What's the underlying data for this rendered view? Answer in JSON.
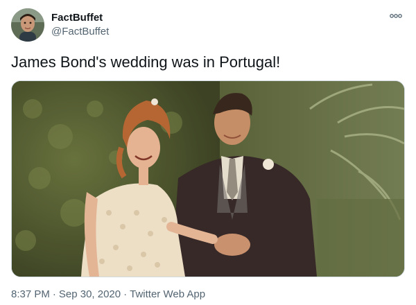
{
  "author": {
    "display_name": "FactBuffet",
    "handle": "@FactBuffet",
    "avatar_icon": "user-avatar-photo"
  },
  "menu": {
    "icon": "more-options-icon"
  },
  "tweet": {
    "text": "James Bond's wedding was in Portugal!",
    "media_icon": "wedding-photo"
  },
  "meta": {
    "time": "8:37 PM",
    "separator": "·",
    "date": "Sep 30, 2020",
    "source": "Twitter Web App"
  },
  "colors": {
    "text_primary": "#0f1419",
    "text_secondary": "#536471",
    "border": "#cfd9de"
  }
}
